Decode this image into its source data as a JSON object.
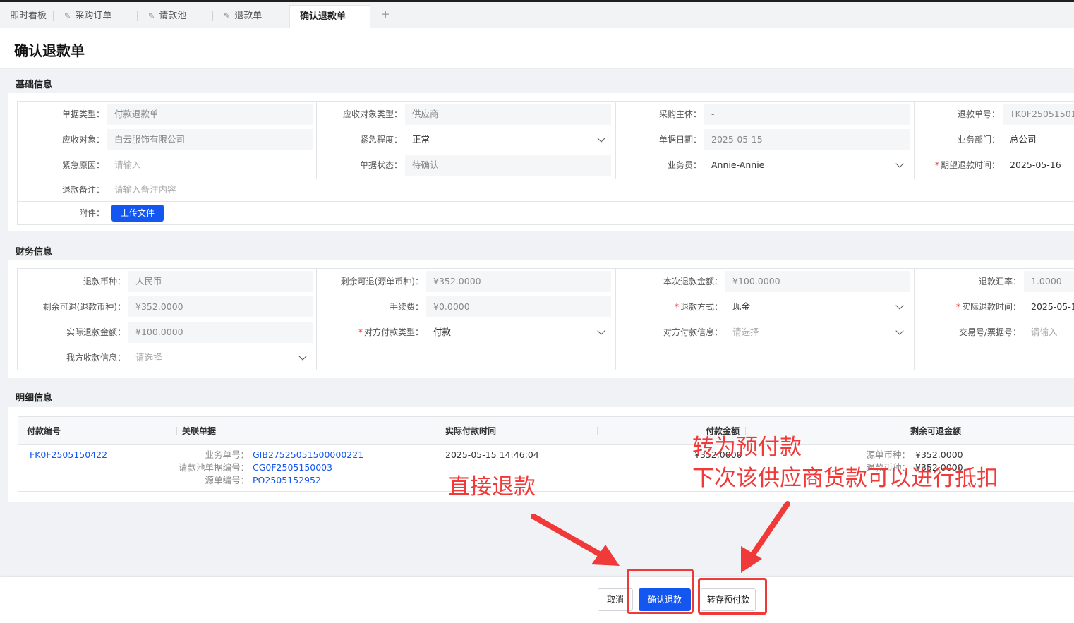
{
  "tabs": [
    {
      "label": "即时看板"
    },
    {
      "label": "采购订单"
    },
    {
      "label": "请款池"
    },
    {
      "label": "退款单"
    },
    {
      "label": "确认退款单"
    }
  ],
  "tab_add": "+",
  "page_title": "确认退款单",
  "basic": {
    "section_title": "基础信息",
    "fields": {
      "doc_type": {
        "label": "单据类型：",
        "value": "付款退款单"
      },
      "recv_target_type": {
        "label": "应收对象类型：",
        "value": "供应商"
      },
      "purchase_entity": {
        "label": "采购主体：",
        "value": "-"
      },
      "refund_no": {
        "label": "退款单号：",
        "value": "TK0F25051501"
      },
      "recv_target": {
        "label": "应收对象：",
        "value": "白云服饰有限公司"
      },
      "urgency": {
        "label": "紧急程度：",
        "value": "正常"
      },
      "doc_date": {
        "label": "单据日期：",
        "value": "2025-05-15"
      },
      "department": {
        "label": "业务部门：",
        "value": "总公司"
      },
      "urgent_reason": {
        "label": "紧急原因：",
        "placeholder": "请输入"
      },
      "doc_status": {
        "label": "单据状态：",
        "value": "待确认"
      },
      "salesperson": {
        "label": "业务员：",
        "value": "Annie-Annie"
      },
      "expected_time": {
        "label": "期望退款时间：",
        "value": "2025-05-16"
      },
      "remark": {
        "label": "退款备注：",
        "placeholder": "请输入备注内容"
      },
      "attachment": {
        "label": "附件：",
        "button": "上传文件"
      }
    }
  },
  "finance": {
    "section_title": "财务信息",
    "fields": {
      "currency": {
        "label": "退款币种：",
        "value": "人民币"
      },
      "remain_src": {
        "label": "剩余可退(源单币种)：",
        "value": "¥352.0000"
      },
      "this_amount": {
        "label": "本次退款金额：",
        "value": "¥100.0000"
      },
      "rate": {
        "label": "退款汇率：",
        "value": "1.0000"
      },
      "remain_refund": {
        "label": "剩余可退(退款币种)：",
        "value": "¥352.0000"
      },
      "fee": {
        "label": "手续费：",
        "value": "¥0.0000"
      },
      "method": {
        "label": "退款方式：",
        "value": "现金"
      },
      "actual_time": {
        "label": "实际退款时间：",
        "value": "2025-05-1"
      },
      "actual_amount": {
        "label": "实际退款金额：",
        "value": "¥100.0000"
      },
      "counter_type": {
        "label": "对方付款类型：",
        "value": "付款"
      },
      "counter_info": {
        "label": "对方付款信息：",
        "placeholder": "请选择"
      },
      "trade_no": {
        "label": "交易号/票据号：",
        "placeholder": "请输入"
      },
      "our_info": {
        "label": "我方收款信息：",
        "placeholder": "请选择"
      }
    }
  },
  "detail": {
    "section_title": "明细信息",
    "columns": [
      "付款编号",
      "关联单据",
      "实际付款时间",
      "付款金额",
      "剩余可退金额"
    ],
    "row": {
      "pay_no": "FK0F2505150422",
      "rel": [
        {
          "label": "业务单号：",
          "value": "GIB27525051500000221"
        },
        {
          "label": "请款池单据编号：",
          "value": "CG0F2505150003"
        },
        {
          "label": "源单编号：",
          "value": "PO2505152952"
        }
      ],
      "pay_time": "2025-05-15 14:46:04",
      "amount": "¥352.0000",
      "remain": [
        {
          "label": "源单币种：",
          "value": "¥352.0000"
        },
        {
          "label": "退款币种：",
          "value": "¥352.0000"
        }
      ]
    }
  },
  "buttons": {
    "cancel": "取消",
    "confirm": "确认退款",
    "prepay": "转存预付款"
  },
  "annotations": {
    "direct": "直接退款",
    "prepay_line1": "转为预付款",
    "prepay_line2": "下次该供应商货款可以进行抵扣",
    "color": "#f03a3a"
  },
  "colors": {
    "primary": "#1456f0",
    "required": "#f5222d"
  }
}
